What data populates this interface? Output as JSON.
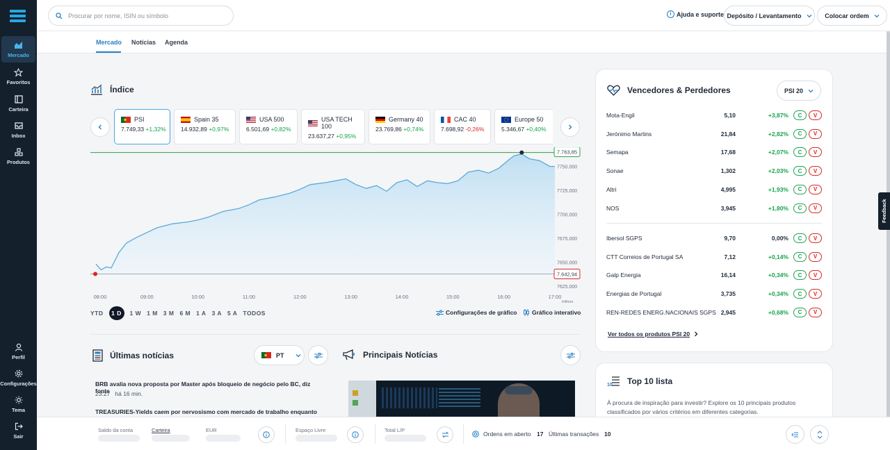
{
  "sidebar": {
    "items": [
      {
        "label": "Mercado",
        "icon": "chart-icon"
      },
      {
        "label": "Favoritos",
        "icon": "star-icon"
      },
      {
        "label": "Carteira",
        "icon": "wallet-icon"
      },
      {
        "label": "Inbox",
        "icon": "inbox-icon"
      },
      {
        "label": "Produtos",
        "icon": "products-icon"
      }
    ],
    "bottom_items": [
      {
        "label": "Perfil",
        "icon": "user-icon"
      },
      {
        "label": "Configurações",
        "icon": "gear-icon"
      },
      {
        "label": "Tema",
        "icon": "sun-icon"
      },
      {
        "label": "Sair",
        "icon": "logout-icon"
      }
    ]
  },
  "header": {
    "search_placeholder": "Procurar por nome, ISIN ou símbolo",
    "help_label": "Ajuda e suporte",
    "deposit_label": "Depósito / Levantamento",
    "order_label": "Colocar ordem"
  },
  "tabs": [
    {
      "label": "Mercado"
    },
    {
      "label": "Notícias"
    },
    {
      "label": "Agenda"
    }
  ],
  "index_section": {
    "title": "Índice",
    "cards": [
      {
        "name": "PSI",
        "value": "7.749,33",
        "change": "+1,32%",
        "dir": "pos"
      },
      {
        "name": "Spain 35",
        "value": "14.932,89",
        "change": "+0,97%",
        "dir": "pos"
      },
      {
        "name": "USA 500",
        "value": "6.501,69",
        "change": "+0,82%",
        "dir": "pos"
      },
      {
        "name": "USA TECH 100",
        "value": "23.637,27",
        "change": "+0,95%",
        "dir": "pos"
      },
      {
        "name": "Germany 40",
        "value": "23.769,86",
        "change": "+0,74%",
        "dir": "pos"
      },
      {
        "name": "CAC 40",
        "value": "7.698,92",
        "change": "-0,26%",
        "dir": "neg"
      },
      {
        "name": "Europe 50",
        "value": "5.346,67",
        "change": "+0,40%",
        "dir": "pos"
      }
    ],
    "periods": [
      "YTD",
      "1 D",
      "1 W",
      "1 M",
      "3 M",
      "6 M",
      "1 A",
      "3 A",
      "5 A",
      "TODOS"
    ],
    "active_period": "1 D",
    "chart_settings_label": "Configurações de gráfico",
    "interactive_label": "Gráfico interativo"
  },
  "chart_data": {
    "type": "area",
    "x_labels": [
      "08:00",
      "09:00",
      "10:00",
      "11:00",
      "12:00",
      "13:00",
      "14:00",
      "15:00",
      "16:00",
      "17:00"
    ],
    "y_ticks": [
      "7750.000",
      "7725.000",
      "7700.000",
      "7675.000",
      "7650.000",
      "7625.000"
    ],
    "y_min": 7625,
    "y_max": 7770,
    "high_label": "7.763,85",
    "low_label": "7.642,94",
    "source_label": "Infinox",
    "hours": [
      8.0,
      8.1,
      8.2,
      8.3,
      8.45,
      8.6,
      8.8,
      9.0,
      9.2,
      9.5,
      9.8,
      10.0,
      10.2,
      10.5,
      10.8,
      11.0,
      11.2,
      11.5,
      11.8,
      12.0,
      12.2,
      12.5,
      12.7,
      12.9,
      13.1,
      13.3,
      13.5,
      13.7,
      13.9,
      14.1,
      14.3,
      14.5,
      14.7,
      14.9,
      15.1,
      15.3,
      15.5,
      15.7,
      15.9,
      16.1,
      16.2,
      16.35,
      16.5,
      16.7,
      16.9,
      17.0
    ],
    "values": [
      7648,
      7642,
      7645,
      7644,
      7660,
      7670,
      7676,
      7681,
      7686,
      7690,
      7692,
      7694,
      7697,
      7703,
      7706,
      7710,
      7715,
      7718,
      7722,
      7726,
      7731,
      7733,
      7735,
      7737,
      7731,
      7727,
      7730,
      7724,
      7733,
      7736,
      7729,
      7735,
      7733,
      7732,
      7735,
      7744,
      7746,
      7743,
      7748,
      7757,
      7761,
      7763,
      7758,
      7756,
      7750,
      7750
    ],
    "line_color": "#5aaad8",
    "high_line_color": "#2f9e44",
    "low_line_color": "#d0d4d9",
    "low_point_color": "#dc2626"
  },
  "news": {
    "title": "Últimas notícias",
    "lang": "PT",
    "items": [
      {
        "headline": "BRB avalia nova proposta por Master após bloqueio de negócio pelo BC, diz fonte",
        "time": "23:27",
        "ago": "há 16 min."
      },
      {
        "headline": "TREASURIES-Yields caem por nervosismo com mercado de trabalho enquanto",
        "time": "",
        "ago": ""
      }
    ]
  },
  "top_news": {
    "title": "Principais Notícias"
  },
  "movers": {
    "title": "Vencedores & Perdedores",
    "selector": "PSI 20",
    "winners": [
      {
        "name": "Mota-Engil",
        "price": "5,10",
        "change": "+3,87%"
      },
      {
        "name": "Jerónimo Martins",
        "price": "21,84",
        "change": "+2,82%"
      },
      {
        "name": "Semapa",
        "price": "17,68",
        "change": "+2,07%"
      },
      {
        "name": "Sonae",
        "price": "1,302",
        "change": "+2,03%"
      },
      {
        "name": "Altri",
        "price": "4,995",
        "change": "+1,93%"
      },
      {
        "name": "NOS",
        "price": "3,945",
        "change": "+1,80%"
      }
    ],
    "losers": [
      {
        "name": "Ibersol SGPS",
        "price": "9,70",
        "change": "0,00%"
      },
      {
        "name": "CTT Correios de Portugal SA",
        "price": "7,12",
        "change": "+0,14%"
      },
      {
        "name": "Galp Energia",
        "price": "16,14",
        "change": "+0,34%"
      },
      {
        "name": "Energias de Portugal",
        "price": "3,735",
        "change": "+0,34%"
      },
      {
        "name": "REN-REDES ENERG.NACIONAIS SGPS",
        "price": "2,945",
        "change": "+0,68%"
      }
    ],
    "buy_label": "C",
    "sell_label": "V",
    "see_all": "Ver todos os produtos PSI 20"
  },
  "top10": {
    "title": "Top 10 lista",
    "description": "À procura de inspiração para investir? Explore os 10 principais produtos classificados por vários critérios em diferentes categorias."
  },
  "bottombar": {
    "balance_label": "Saldo da conta",
    "portfolio_label": "Carteira",
    "currency_label": "EUR",
    "free_space_label": "Espaço Livre",
    "total_pl_label": "Total L/P",
    "open_orders_label": "Ordens em aberto",
    "open_orders_count": "17",
    "last_tx_label": "Últimas transações",
    "last_tx_count": "10"
  },
  "feedback_label": "Feedback",
  "colors": {
    "sidebar_bg": "#14202c",
    "accent": "#2a7fc4",
    "positive": "#16a34a",
    "negative": "#dc2626"
  }
}
